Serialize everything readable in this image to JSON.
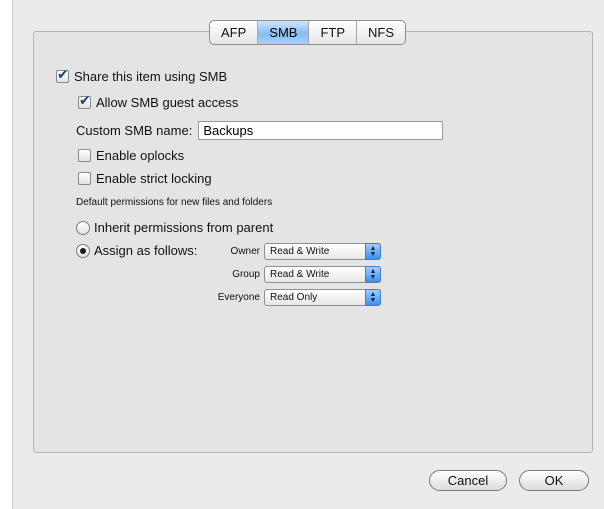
{
  "tabs": [
    {
      "label": "AFP",
      "active": false
    },
    {
      "label": "SMB",
      "active": true
    },
    {
      "label": "FTP",
      "active": false
    },
    {
      "label": "NFS",
      "active": false
    }
  ],
  "share": {
    "label": "Share this item using SMB",
    "checked": true
  },
  "guest": {
    "label": "Allow SMB guest access",
    "checked": true
  },
  "custom_name": {
    "label": "Custom SMB name:",
    "value": "Backups"
  },
  "oplocks": {
    "label": "Enable oplocks",
    "checked": false
  },
  "strict_locking": {
    "label": "Enable strict locking",
    "checked": false
  },
  "default_permissions_heading": "Default permissions for new files and folders",
  "inherit": {
    "label": "Inherit permissions from parent",
    "selected": false
  },
  "assign": {
    "label": "Assign as follows:",
    "selected": true
  },
  "permissions": [
    {
      "who": "Owner",
      "value": "Read & Write"
    },
    {
      "who": "Group",
      "value": "Read & Write"
    },
    {
      "who": "Everyone",
      "value": "Read Only"
    }
  ],
  "popup_arrows_icon": "up-down-arrows-icon",
  "buttons": {
    "cancel": "Cancel",
    "ok": "OK"
  }
}
